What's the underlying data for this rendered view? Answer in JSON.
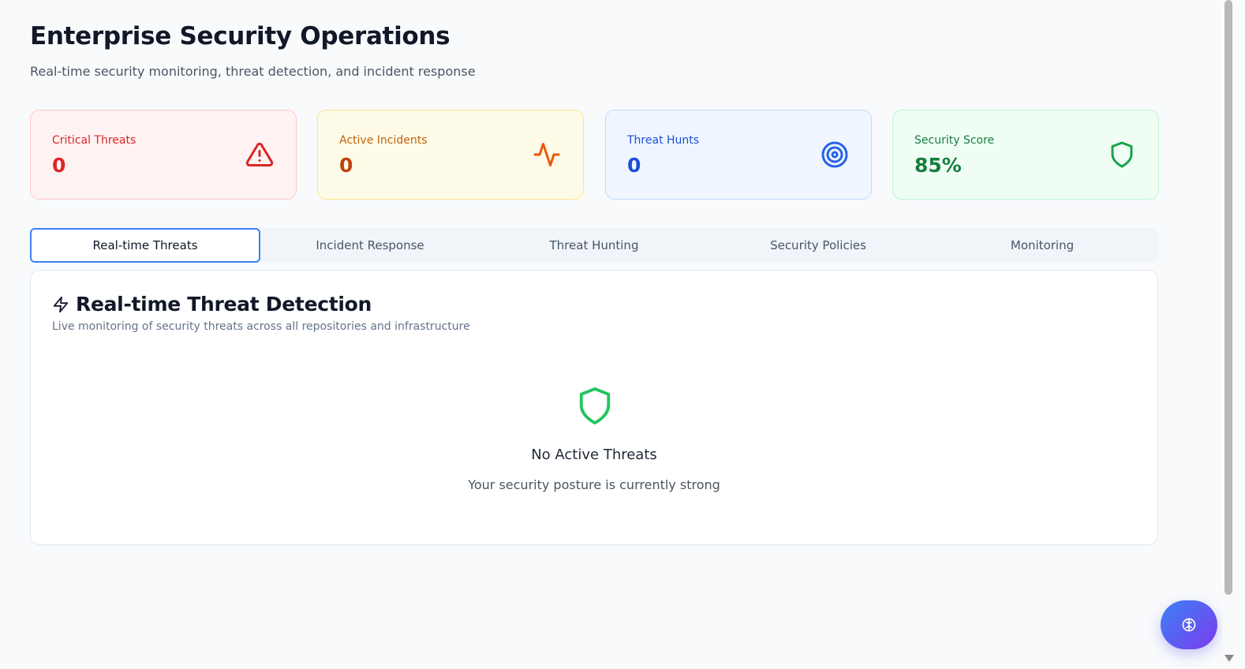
{
  "header": {
    "title": "Enterprise Security Operations",
    "subtitle": "Real-time security monitoring, threat detection, and incident response"
  },
  "stats": [
    {
      "label": "Critical Threats",
      "value": "0",
      "icon": "alert-triangle-icon",
      "color": "#dc2626"
    },
    {
      "label": "Active Incidents",
      "value": "0",
      "icon": "activity-icon",
      "color": "#ea580c"
    },
    {
      "label": "Threat Hunts",
      "value": "0",
      "icon": "target-icon",
      "color": "#2563eb"
    },
    {
      "label": "Security Score",
      "value": "85%",
      "icon": "shield-icon",
      "color": "#16a34a"
    }
  ],
  "tabs": [
    {
      "label": "Real-time Threats",
      "active": true
    },
    {
      "label": "Incident Response",
      "active": false
    },
    {
      "label": "Threat Hunting",
      "active": false
    },
    {
      "label": "Security Policies",
      "active": false
    },
    {
      "label": "Monitoring",
      "active": false
    }
  ],
  "panel": {
    "icon": "zap-icon",
    "title": "Real-time Threat Detection",
    "description": "Live monitoring of security threats across all repositories and infrastructure",
    "empty_state": {
      "icon": "shield-icon",
      "title": "No Active Threats",
      "description": "Your security posture is currently strong"
    }
  },
  "fab": {
    "icon": "brain-icon",
    "gradient": [
      "#3b82f6",
      "#7c3aed"
    ]
  }
}
